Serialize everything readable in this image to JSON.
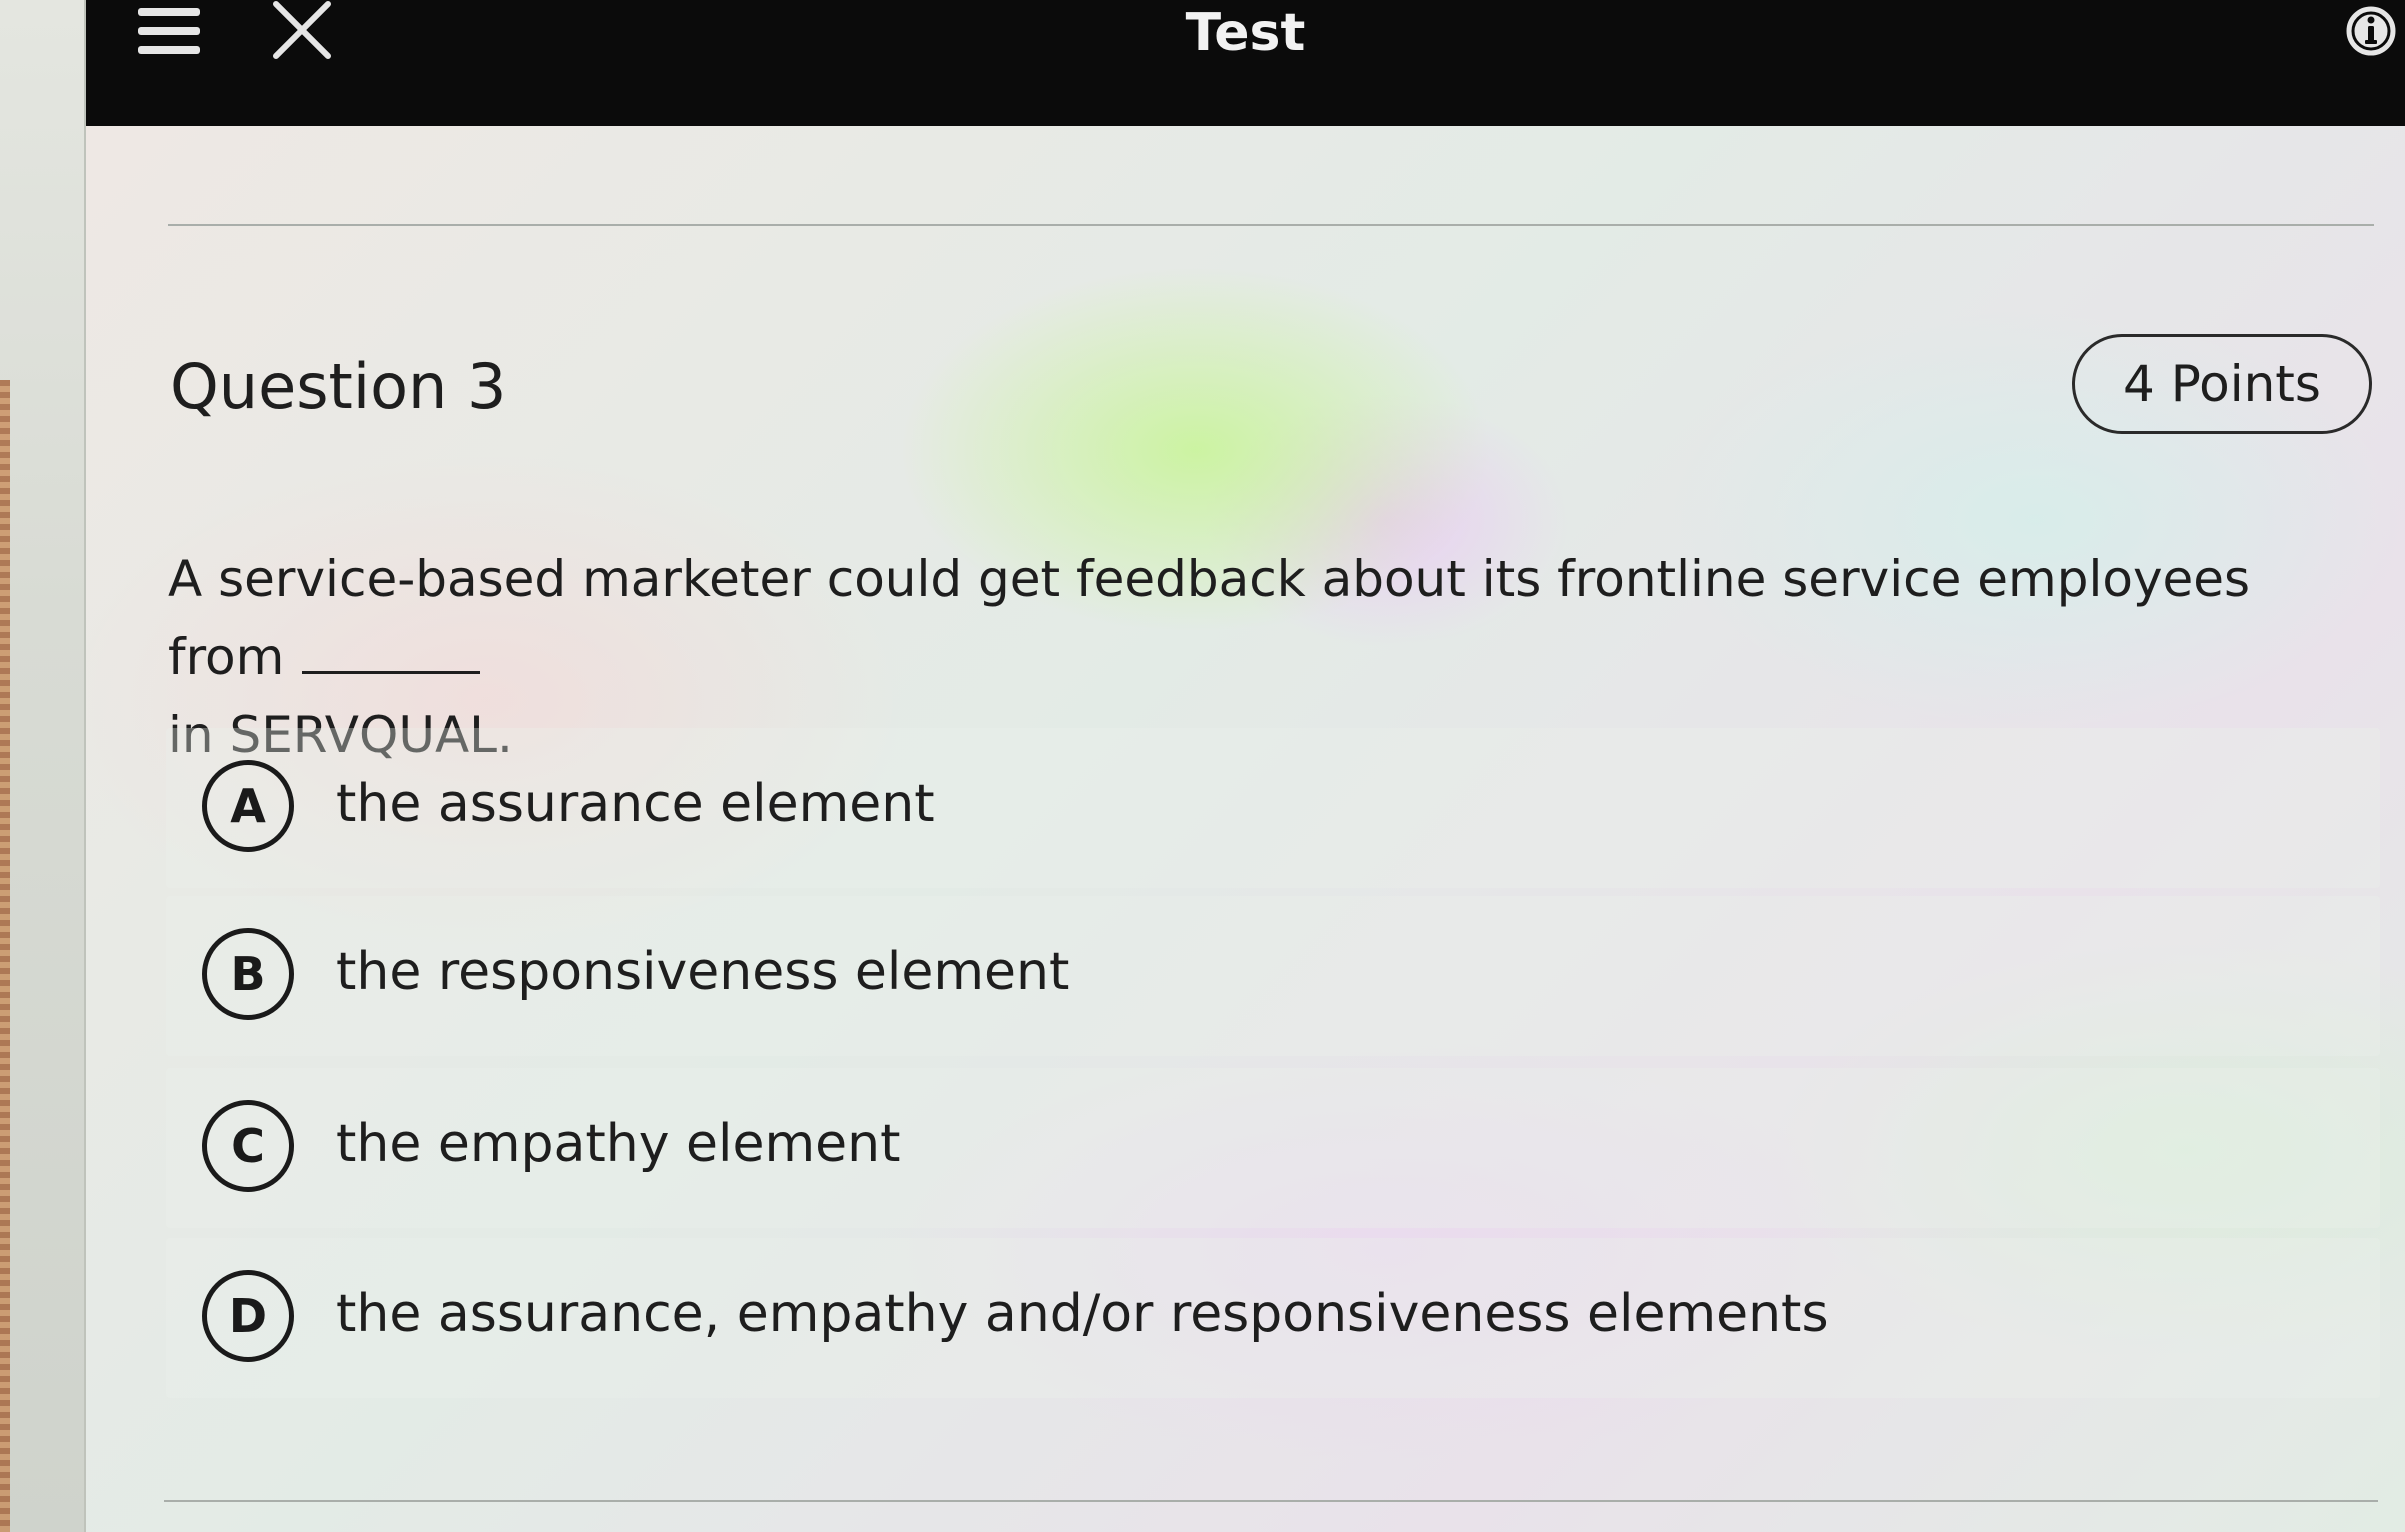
{
  "header": {
    "title": "Test",
    "menu_icon": "hamburger-menu-icon",
    "close_icon": "close-icon",
    "info_icon": "info-icon"
  },
  "question": {
    "title": "Question 3",
    "points": "4 Points",
    "text_before_blank": "A service-based marketer could get feedback about its frontline service employees from",
    "text_after_blank": "in SERVQUAL.",
    "options": [
      {
        "letter": "A",
        "label": "the assurance element"
      },
      {
        "letter": "B",
        "label": "the responsiveness element"
      },
      {
        "letter": "C",
        "label": "the empathy element"
      },
      {
        "letter": "D",
        "label": "the assurance, empathy and/or responsiveness elements"
      }
    ]
  }
}
